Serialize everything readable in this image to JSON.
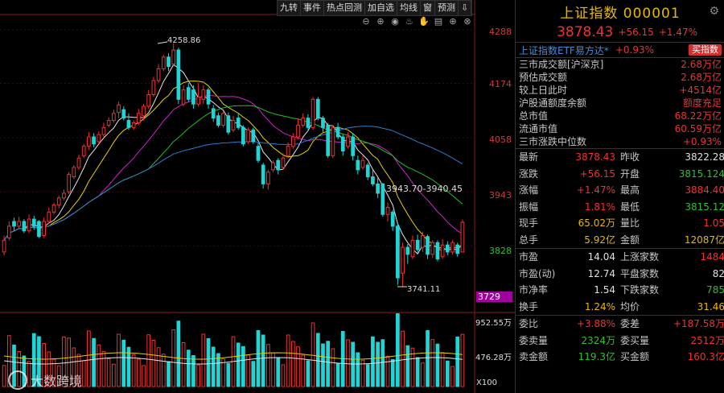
{
  "toolbar": {
    "items": [
      "九转",
      "事件",
      "热点回测",
      "加自选",
      "均线",
      "窗",
      "预测",
      "⇩"
    ]
  },
  "icon_bar": [
    "zoom-out",
    "zoom-in",
    "eye",
    "cup",
    "hand",
    "print",
    "plus",
    "close"
  ],
  "chart": {
    "y_labels": [
      "4288",
      "4174",
      "4058",
      "3943",
      "3828"
    ],
    "current_price_box": "3729",
    "high_annotation": "4258.86",
    "low_annotation": "3741.11",
    "range_annotation": "3943.70-3940.45",
    "volume_labels": [
      "952.55万",
      "476.28万"
    ],
    "volume_unit": "X100",
    "watermark": "大数跨境",
    "colors": {
      "up": "#f23030",
      "down": "#1fd5d5",
      "ma5": "#e6e6e6",
      "ma10": "#e8d000",
      "ma20": "#d020d0",
      "ma30": "#20c020",
      "ma60": "#2a7fd0"
    }
  },
  "chart_data": {
    "type": "candlestick",
    "y_range": [
      3700,
      4300
    ],
    "candles": [
      {
        "o": 3815,
        "c": 3840,
        "h": 3850,
        "l": 3808
      },
      {
        "o": 3845,
        "c": 3870,
        "h": 3880,
        "l": 3840
      },
      {
        "o": 3880,
        "c": 3870,
        "h": 3888,
        "l": 3860
      },
      {
        "o": 3870,
        "c": 3880,
        "h": 3890,
        "l": 3865
      },
      {
        "o": 3880,
        "c": 3860,
        "h": 3885,
        "l": 3855
      },
      {
        "o": 3860,
        "c": 3885,
        "h": 3895,
        "l": 3855
      },
      {
        "o": 3885,
        "c": 3870,
        "h": 3892,
        "l": 3862
      },
      {
        "o": 3880,
        "c": 3848,
        "h": 3883,
        "l": 3845
      },
      {
        "o": 3850,
        "c": 3880,
        "h": 3888,
        "l": 3845
      },
      {
        "o": 3880,
        "c": 3900,
        "h": 3910,
        "l": 3875
      },
      {
        "o": 3900,
        "c": 3915,
        "h": 3920,
        "l": 3895
      },
      {
        "o": 3915,
        "c": 3930,
        "h": 3935,
        "l": 3908
      },
      {
        "o": 3930,
        "c": 3940,
        "h": 3948,
        "l": 3925
      },
      {
        "o": 3943,
        "c": 3980,
        "h": 3985,
        "l": 3938
      },
      {
        "o": 3975,
        "c": 3995,
        "h": 4000,
        "l": 3970
      },
      {
        "o": 3995,
        "c": 4015,
        "h": 4022,
        "l": 3990
      },
      {
        "o": 4020,
        "c": 4040,
        "h": 4045,
        "l": 4015
      },
      {
        "o": 4040,
        "c": 4060,
        "h": 4070,
        "l": 4032
      },
      {
        "o": 4060,
        "c": 4045,
        "h": 4068,
        "l": 4038
      },
      {
        "o": 4050,
        "c": 4065,
        "h": 4072,
        "l": 4045
      },
      {
        "o": 4065,
        "c": 4080,
        "h": 4090,
        "l": 4060
      },
      {
        "o": 4085,
        "c": 4095,
        "h": 4102,
        "l": 4080
      },
      {
        "o": 4095,
        "c": 4110,
        "h": 4118,
        "l": 4090
      },
      {
        "o": 4112,
        "c": 4128,
        "h": 4135,
        "l": 4100
      },
      {
        "o": 4118,
        "c": 4100,
        "h": 4125,
        "l": 4095
      },
      {
        "o": 4095,
        "c": 4080,
        "h": 4110,
        "l": 4075
      },
      {
        "o": 4080,
        "c": 4090,
        "h": 4095,
        "l": 4075
      },
      {
        "o": 4090,
        "c": 4110,
        "h": 4120,
        "l": 4085
      },
      {
        "o": 4105,
        "c": 4125,
        "h": 4130,
        "l": 4095
      },
      {
        "o": 4125,
        "c": 4150,
        "h": 4160,
        "l": 4120
      },
      {
        "o": 4150,
        "c": 4180,
        "h": 4188,
        "l": 4145
      },
      {
        "o": 4180,
        "c": 4205,
        "h": 4215,
        "l": 4175
      },
      {
        "o": 4205,
        "c": 4230,
        "h": 4235,
        "l": 4200
      },
      {
        "o": 4230,
        "c": 4210,
        "h": 4238,
        "l": 4200
      },
      {
        "o": 4215,
        "c": 4245,
        "h": 4258.86,
        "l": 4210
      },
      {
        "o": 4245,
        "c": 4140,
        "h": 4250,
        "l": 4130
      },
      {
        "o": 4130,
        "c": 4160,
        "h": 4170,
        "l": 4125
      },
      {
        "o": 4165,
        "c": 4140,
        "h": 4175,
        "l": 4135
      },
      {
        "o": 4160,
        "c": 4130,
        "h": 4170,
        "l": 4120
      },
      {
        "o": 4130,
        "c": 4145,
        "h": 4175,
        "l": 4125
      },
      {
        "o": 4140,
        "c": 4160,
        "h": 4170,
        "l": 4130
      },
      {
        "o": 4160,
        "c": 4130,
        "h": 4165,
        "l": 4120
      },
      {
        "o": 4120,
        "c": 4100,
        "h": 4128,
        "l": 4092
      },
      {
        "o": 4105,
        "c": 4085,
        "h": 4112,
        "l": 4080
      },
      {
        "o": 4085,
        "c": 4110,
        "h": 4115,
        "l": 4080
      },
      {
        "o": 4105,
        "c": 4070,
        "h": 4112,
        "l": 4065
      },
      {
        "o": 4075,
        "c": 4095,
        "h": 4105,
        "l": 4070
      },
      {
        "o": 4100,
        "c": 4080,
        "h": 4110,
        "l": 4075
      },
      {
        "o": 4080,
        "c": 4045,
        "h": 4085,
        "l": 4040
      },
      {
        "o": 4050,
        "c": 4075,
        "h": 4080,
        "l": 4045
      },
      {
        "o": 4075,
        "c": 4050,
        "h": 4080,
        "l": 4045
      },
      {
        "o": 4040,
        "c": 4010,
        "h": 4048,
        "l": 4005
      },
      {
        "o": 4000,
        "c": 3960,
        "h": 4005,
        "l": 3950
      },
      {
        "o": 3960,
        "c": 3985,
        "h": 3990,
        "l": 3948
      },
      {
        "o": 3990,
        "c": 4005,
        "h": 4010,
        "l": 3985
      },
      {
        "o": 4010,
        "c": 3990,
        "h": 4015,
        "l": 3980
      },
      {
        "o": 3995,
        "c": 4015,
        "h": 4025,
        "l": 3990
      },
      {
        "o": 4020,
        "c": 4040,
        "h": 4048,
        "l": 4015
      },
      {
        "o": 4040,
        "c": 4060,
        "h": 4068,
        "l": 4035
      },
      {
        "o": 4060,
        "c": 4085,
        "h": 4100,
        "l": 4055
      },
      {
        "o": 4085,
        "c": 4100,
        "h": 4110,
        "l": 4080
      },
      {
        "o": 4100,
        "c": 4080,
        "h": 4108,
        "l": 4075
      },
      {
        "o": 4080,
        "c": 4140,
        "h": 4145,
        "l": 4075
      },
      {
        "o": 4140,
        "c": 4100,
        "h": 4145,
        "l": 4095
      },
      {
        "o": 4100,
        "c": 4080,
        "h": 4105,
        "l": 4070
      },
      {
        "o": 4085,
        "c": 4020,
        "h": 4090,
        "l": 4015
      },
      {
        "o": 4020,
        "c": 4080,
        "h": 4085,
        "l": 4015
      },
      {
        "o": 4080,
        "c": 4060,
        "h": 4090,
        "l": 4055
      },
      {
        "o": 4060,
        "c": 4030,
        "h": 4065,
        "l": 4020
      },
      {
        "o": 4040,
        "c": 4060,
        "h": 4070,
        "l": 4035
      },
      {
        "o": 4060,
        "c": 4020,
        "h": 4068,
        "l": 4010
      },
      {
        "o": 4010,
        "c": 3990,
        "h": 4020,
        "l": 3980
      },
      {
        "o": 3995,
        "c": 4010,
        "h": 4020,
        "l": 3990
      },
      {
        "o": 4000,
        "c": 3975,
        "h": 4005,
        "l": 3968
      },
      {
        "o": 3975,
        "c": 3960,
        "h": 3990,
        "l": 3955
      },
      {
        "o": 3960,
        "c": 3940,
        "h": 3975,
        "l": 3930
      },
      {
        "o": 3960,
        "c": 3895,
        "h": 3962,
        "l": 3890
      },
      {
        "o": 3895,
        "c": 3910,
        "h": 3920,
        "l": 3880
      },
      {
        "o": 3900,
        "c": 3870,
        "h": 3905,
        "l": 3860
      },
      {
        "o": 3870,
        "c": 3760,
        "h": 3875,
        "l": 3745
      },
      {
        "o": 3770,
        "c": 3825,
        "h": 3835,
        "l": 3741.11
      },
      {
        "o": 3825,
        "c": 3810,
        "h": 3832,
        "l": 3790
      },
      {
        "o": 3805,
        "c": 3840,
        "h": 3850,
        "l": 3800
      },
      {
        "o": 3840,
        "c": 3820,
        "h": 3852,
        "l": 3810
      },
      {
        "o": 3825,
        "c": 3850,
        "h": 3858,
        "l": 3815
      },
      {
        "o": 3848,
        "c": 3810,
        "h": 3852,
        "l": 3800
      },
      {
        "o": 3810,
        "c": 3835,
        "h": 3840,
        "l": 3802
      },
      {
        "o": 3835,
        "c": 3800,
        "h": 3840,
        "l": 3795
      },
      {
        "o": 3805,
        "c": 3830,
        "h": 3842,
        "l": 3800
      },
      {
        "o": 3830,
        "c": 3815,
        "h": 3838,
        "l": 3808
      },
      {
        "o": 3815,
        "c": 3835,
        "h": 3840,
        "l": 3810
      },
      {
        "o": 3830,
        "c": 3812,
        "h": 3835,
        "l": 3805
      },
      {
        "o": 3815,
        "c": 3878.43,
        "h": 3884.4,
        "l": 3815.12
      }
    ]
  },
  "panel": {
    "title": "上证指数 000001",
    "price": "3878.43",
    "change": "+56.15",
    "change_pct": "+1.47%",
    "etf_name": "上证指数ETF易方达*",
    "etf_pct": "+0.93%",
    "buy_button": "买指数",
    "info_rows": [
      {
        "k": "三市成交额[沪深京]",
        "v": "2.68万亿"
      },
      {
        "k": "预估成交额",
        "v": "2.68万亿"
      },
      {
        "k": "较上日此时",
        "v": "+4514亿"
      },
      {
        "k": "沪股通额度余额",
        "v": "额度充足"
      },
      {
        "k": "总市值",
        "v": "68.22万亿"
      },
      {
        "k": "流通市值",
        "v": "60.59万亿"
      },
      {
        "k": "三市涨跌中位数",
        "v": "+0.93%"
      }
    ],
    "quote_rows": [
      {
        "k1": "最新",
        "v1": "3878.43",
        "c1": "red",
        "k2": "昨收",
        "v2": "3822.28",
        "c2": "wht"
      },
      {
        "k1": "涨跌",
        "v1": "+56.15",
        "c1": "red",
        "k2": "开盘",
        "v2": "3815.124",
        "c2": "grn"
      },
      {
        "k1": "涨幅",
        "v1": "+1.47%",
        "c1": "red",
        "k2": "最高",
        "v2": "3884.40",
        "c2": "red"
      },
      {
        "k1": "振幅",
        "v1": "1.81%",
        "c1": "red",
        "k2": "最低",
        "v2": "3815.12",
        "c2": "grn"
      },
      {
        "k1": "现手",
        "v1": "65.02万",
        "c1": "yel",
        "k2": "量比",
        "v2": "1.05",
        "c2": "red"
      },
      {
        "k1": "总手",
        "v1": "5.92亿",
        "c1": "yel",
        "k2": "金额",
        "v2": "12087亿",
        "c2": "yel"
      }
    ],
    "quote_rows2": [
      {
        "k1": "市盈",
        "v1": "14.04",
        "c1": "wht",
        "k2": "上涨家数",
        "v2": "1484",
        "c2": "red"
      },
      {
        "k1": "市盈(动)",
        "v1": "12.74",
        "c1": "wht",
        "k2": "平盘家数",
        "v2": "82",
        "c2": "wht"
      },
      {
        "k1": "市净率",
        "v1": "1.54",
        "c1": "wht",
        "k2": "下跌家数",
        "v2": "785",
        "c2": "grn"
      },
      {
        "k1": "换手",
        "v1": "1.24%",
        "c1": "yel",
        "k2": "均价",
        "v2": "31.46",
        "c2": "yel"
      }
    ],
    "quote_rows3": [
      {
        "k1": "委比",
        "v1": "+3.88%",
        "c1": "red",
        "k2": "委差",
        "v2": "+187.58万",
        "c2": "red"
      },
      {
        "k1": "委卖量",
        "v1": "2324万",
        "c1": "grn",
        "k2": "委买量",
        "v2": "2512万",
        "c2": "red"
      },
      {
        "k1": "卖金额",
        "v1": "119.3亿",
        "c1": "grn",
        "k2": "买金额",
        "v2": "160.3亿",
        "c2": "red"
      }
    ]
  }
}
